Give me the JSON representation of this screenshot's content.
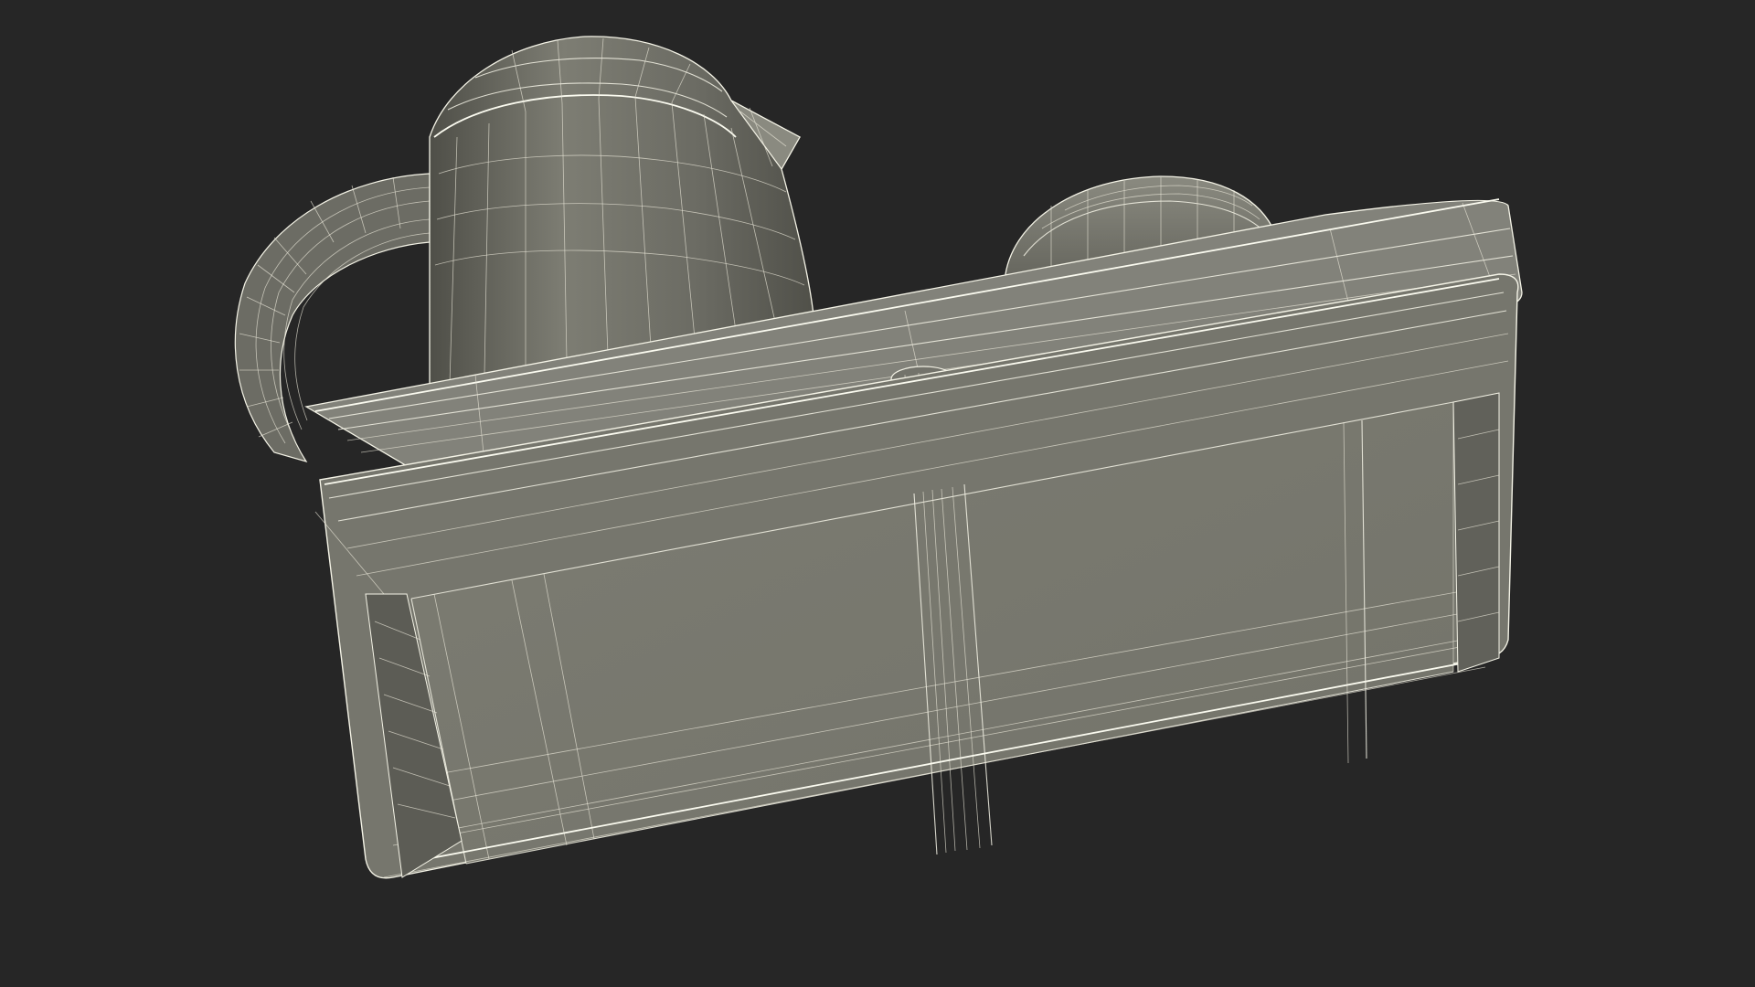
{
  "scene": {
    "subject": "",
    "background_color": "#262626",
    "surface_color": "#7a7a70",
    "surface_shadow": "#5e5e56",
    "wire_color": "#f4f3e6"
  }
}
